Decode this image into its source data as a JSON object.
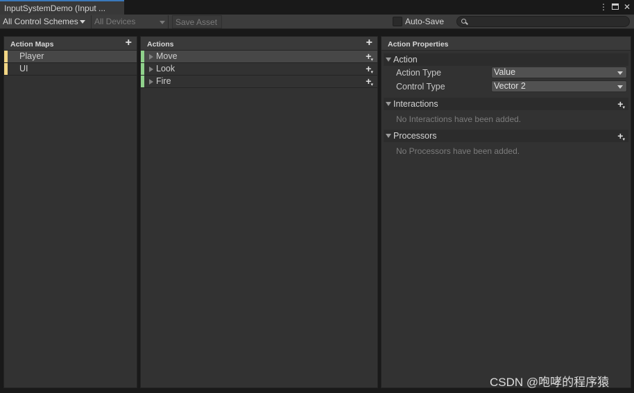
{
  "window": {
    "tab_title": "InputSystemDemo (Input ...",
    "icons": [
      "more-vert-icon",
      "maximize-icon",
      "close-icon"
    ]
  },
  "toolbar": {
    "control_schemes": "All Control Schemes",
    "devices": "All Devices",
    "save_asset": "Save Asset",
    "auto_save_label": "Auto-Save",
    "auto_save_checked": false,
    "search_value": ""
  },
  "action_maps": {
    "header": "Action Maps",
    "items": [
      {
        "label": "Player",
        "selected": true
      },
      {
        "label": "UI",
        "selected": false
      }
    ]
  },
  "actions": {
    "header": "Actions",
    "items": [
      {
        "label": "Move",
        "selected": true
      },
      {
        "label": "Look",
        "selected": false
      },
      {
        "label": "Fire",
        "selected": false
      }
    ]
  },
  "properties": {
    "header": "Action Properties",
    "action_section": "Action",
    "action_type_label": "Action Type",
    "action_type_value": "Value",
    "control_type_label": "Control Type",
    "control_type_value": "Vector 2",
    "interactions_section": "Interactions",
    "interactions_empty": "No Interactions have been added.",
    "processors_section": "Processors",
    "processors_empty": "No Processors have been added."
  },
  "watermark": "CSDN @咆哮的程序猿",
  "colors": {
    "tab_accent": "#3a79bb",
    "map_stripe": "#f2d684",
    "action_stripe": "#8fd18b"
  }
}
